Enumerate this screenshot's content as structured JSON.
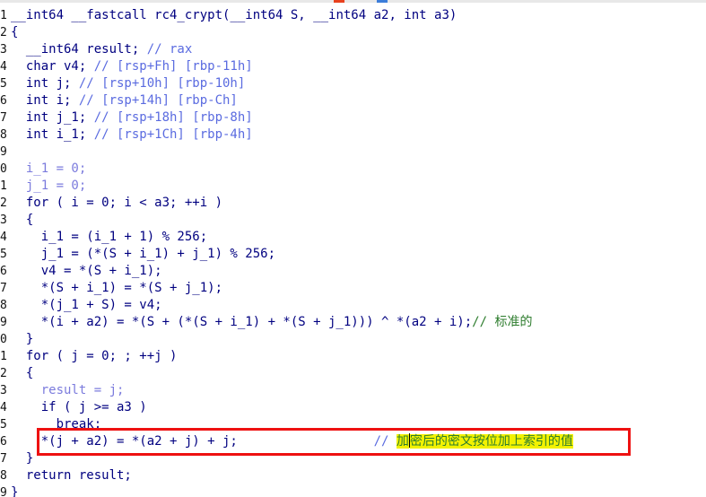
{
  "editor": {
    "gutter": [
      "1",
      "2",
      "3",
      "4",
      "5",
      "6",
      "7",
      "8",
      "9",
      "0",
      "1",
      "2",
      "3",
      "4",
      "5",
      "6",
      "7",
      "8",
      "9",
      "0",
      "1",
      "2",
      "3",
      "4",
      "5",
      "6",
      "7",
      "8",
      "9"
    ]
  },
  "code": {
    "sig": {
      "a": "__int64 __fastcall rc4_crypt(",
      "b": "__int64 S, __int64 a2, int a3)"
    },
    "open": "{",
    "decl_result": {
      "a": "  __int64 result; ",
      "b": "// rax"
    },
    "decl_v4": {
      "a": "  char v4; ",
      "b": "// [rsp+Fh] [rbp-11h]"
    },
    "decl_j": {
      "a": "  int j; ",
      "b": "// [rsp+10h] [rbp-10h]"
    },
    "decl_i": {
      "a": "  int i; ",
      "b": "// [rsp+14h] [rbp-Ch]"
    },
    "decl_j1": {
      "a": "  int j_1; ",
      "b": "// [rsp+18h] [rbp-8h]"
    },
    "decl_i1": {
      "a": "  int i_1; ",
      "b": "// [rsp+1Ch] [rbp-4h]"
    },
    "blank": "",
    "init_i1": "  i_1 = 0;",
    "init_j1": "  j_1 = 0;",
    "for1": "  for ( i = 0; i < a3; ++i )",
    "brace1": "  {",
    "s1": "    i_1 = (i_1 + 1) % 256;",
    "s2": "    j_1 = (*(S + i_1) + j_1) % 256;",
    "s3": "    v4 = *(S + i_1);",
    "s4": "    *(S + i_1) = *(S + j_1);",
    "s5": "    *(j_1 + S) = v4;",
    "s6": {
      "a": "    *(i + a2) = *(S + (*(S + i_1) + *(S + j_1))) ^ *(a2 + i);",
      "b": "// 标准的"
    },
    "brace1c": "  }",
    "for2": "  for ( j = 0; ; ++j )",
    "brace2": "  {",
    "r1": "    result = j;",
    "r2": "    if ( j >= a3 )",
    "r3": "      break;",
    "r4": {
      "a": "    *(j + a2) = *(a2 + j) + j;",
      "pad": "                  ",
      "c": "// ",
      "d1": "加",
      "d2": "密后的密文按位加上索引的值"
    },
    "brace2c": "  }",
    "ret": "  return result;",
    "close": "}"
  },
  "colors": {
    "keyword": "#000080",
    "identifier": "#7b7bdd",
    "comment": "#5a6be0",
    "highlight_border": "#ee1111",
    "text_highlight": "#f2f200"
  }
}
